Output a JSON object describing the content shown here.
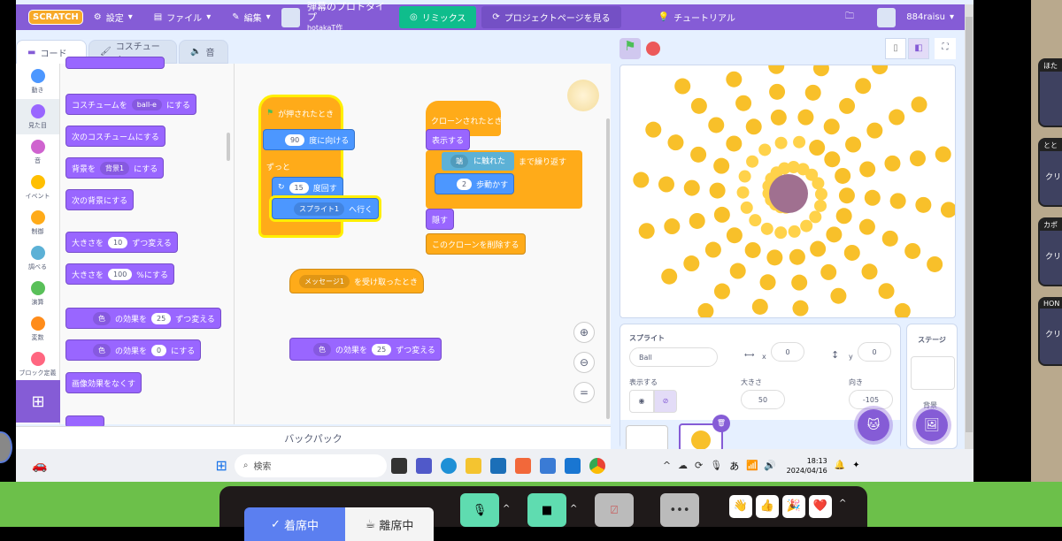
{
  "menu": {
    "logo": "SCRATCH",
    "settings": "設定",
    "file": "ファイル",
    "edit": "編集",
    "project_title": "弾幕のプロトタイプ",
    "author": "hotakaT作",
    "remix": "リミックス",
    "project_page": "プロジェクトページを見る",
    "tutorial": "チュートリアル",
    "username": "884raisu"
  },
  "tabs": {
    "code": "コード",
    "costume": "コスチューム",
    "sound": "音"
  },
  "categories": [
    {
      "label": "動き",
      "color": "#4c97ff"
    },
    {
      "label": "見た目",
      "color": "#9966ff"
    },
    {
      "label": "音",
      "color": "#cf63cf"
    },
    {
      "label": "イベント",
      "color": "#ffbf00"
    },
    {
      "label": "制御",
      "color": "#ffab19"
    },
    {
      "label": "調べる",
      "color": "#5cb1d6"
    },
    {
      "label": "演算",
      "color": "#59c059"
    },
    {
      "label": "変数",
      "color": "#ff8c1a"
    },
    {
      "label": "ブロック定義",
      "color": "#ff6680"
    }
  ],
  "palette": {
    "costume_pre": "コスチュームを",
    "costume_dd": "ball-e",
    "costume_post": "にする",
    "next_costume": "次のコスチュームにする",
    "backdrop_pre": "背景を",
    "backdrop_dd": "背景1",
    "backdrop_post": "にする",
    "next_backdrop": "次の背景にする",
    "size_change_pre": "大きさを",
    "size_change_val": "10",
    "size_change_post": "ずつ変える",
    "size_set_pre": "大きさを",
    "size_set_val": "100",
    "size_set_post": "%にする",
    "effect_change_dd": "色",
    "effect_change_mid": "の効果を",
    "effect_change_val": "25",
    "effect_change_post": "ずつ変える",
    "effect_set_dd": "色",
    "effect_set_mid": "の効果を",
    "effect_set_val": "0",
    "effect_set_post": "にする",
    "clear_effects": "画像効果をなくす"
  },
  "scripts": {
    "flag_hat": "が押されたとき",
    "point_val": "90",
    "point_post": "度に向ける",
    "forever": "ずっと",
    "turn_val": "15",
    "turn_post": "度回す",
    "goto_dd": "スプライト1",
    "goto_post": "へ行く",
    "clone_hat": "クローンされたとき",
    "show": "表示する",
    "touch_dd": "端",
    "touch_post": "に触れた",
    "repeat_until": "まで繰り返す",
    "move_val": "2",
    "move_post": "歩動かす",
    "hide": "隠す",
    "delete_clone": "このクローンを削除する",
    "msg_dd": "メッセージ1",
    "msg_post": "を受け取ったとき",
    "eff_dd": "色",
    "eff_mid": "の効果を",
    "eff_val": "25",
    "eff_post": "ずつ変える"
  },
  "backpack": "バックパック",
  "sprite_info": {
    "label": "スプライト",
    "name": "Ball",
    "x_label": "x",
    "x": "0",
    "y_label": "y",
    "y": "0",
    "show_label": "表示する",
    "size_label": "大きさ",
    "size": "50",
    "direction_label": "向き",
    "direction": "-105"
  },
  "stage_panel": {
    "label": "ステージ",
    "backdrops": "背景"
  },
  "taskbar": {
    "search": "検索",
    "ime": "あ",
    "time": "18:13",
    "date": "2024/04/16"
  },
  "side_cards": [
    {
      "name": "ほた",
      "text": ""
    },
    {
      "name": "とと",
      "text": "クリ"
    },
    {
      "name": "カポ",
      "text": "クリ"
    },
    {
      "name": "HON",
      "text": "クリ"
    }
  ],
  "controls": {
    "present": "着席中",
    "away": "離席中",
    "reactions": [
      "👋",
      "👍",
      "🎉",
      "❤️"
    ]
  }
}
